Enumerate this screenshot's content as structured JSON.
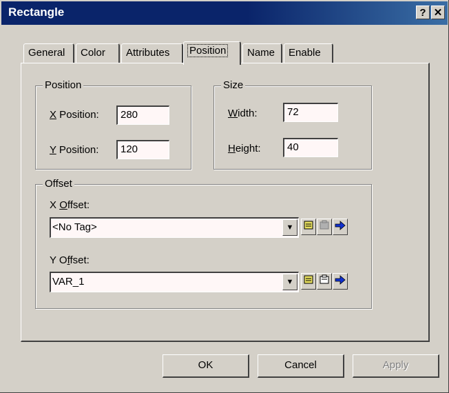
{
  "window": {
    "title": "Rectangle",
    "help_glyph": "?",
    "close_glyph": "✕"
  },
  "tabs": [
    {
      "label": "General",
      "active": false
    },
    {
      "label": "Color",
      "active": false
    },
    {
      "label": "Attributes",
      "active": false
    },
    {
      "label": "Position",
      "active": true
    },
    {
      "label": "Name",
      "active": false
    },
    {
      "label": "Enable",
      "active": false
    }
  ],
  "position_group": {
    "legend": "Position",
    "x_label_hotkey": "X",
    "x_label_rest": " Position:",
    "x_value": "280",
    "y_label_hotkey": "Y",
    "y_label_rest": " Position:",
    "y_value": "120"
  },
  "size_group": {
    "legend": "Size",
    "width_label_hotkey": "W",
    "width_label_rest": "idth:",
    "width_value": "72",
    "height_label_hotkey": "H",
    "height_label_rest": "eight:",
    "height_value": "40"
  },
  "offset_group": {
    "legend": "Offset",
    "x_label_pre": "X ",
    "x_label_hotkey": "O",
    "x_label_rest": "ffset:",
    "x_value": "<No Tag>",
    "y_label_pre": "Y O",
    "y_label_hotkey": "f",
    "y_label_rest": "fset:",
    "y_value": "VAR_1"
  },
  "icons": {
    "dropdown": "dropdown-arrow-icon",
    "browse": "tag-browser-icon",
    "properties": "tag-properties-icon",
    "goto": "goto-arrow-icon"
  },
  "buttons": {
    "ok": "OK",
    "cancel": "Cancel",
    "apply": "Apply"
  },
  "colors": {
    "titlebar": "#0a246a",
    "face": "#d4d0c8",
    "field_bg": "#fff7f7"
  }
}
